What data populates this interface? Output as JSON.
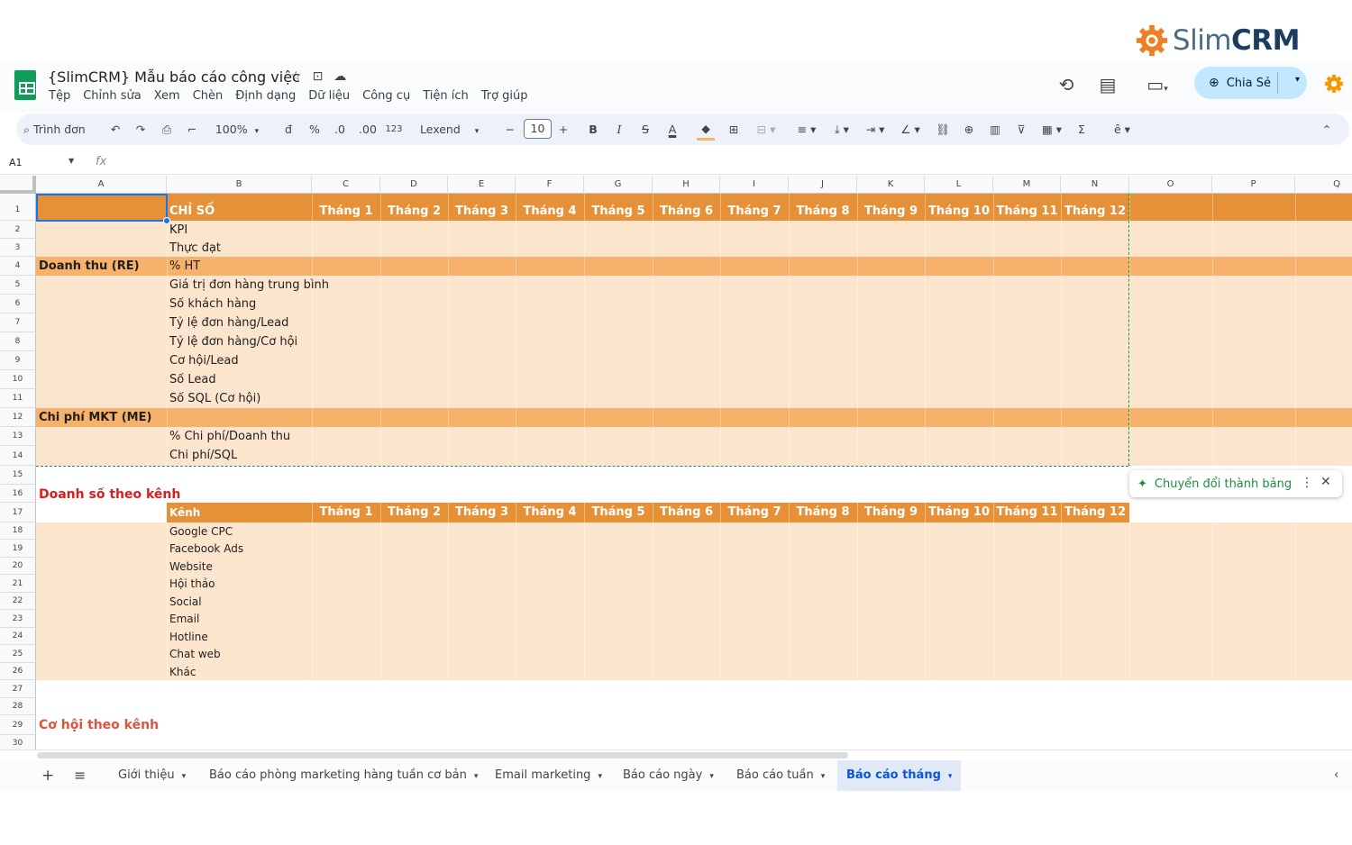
{
  "brand": {
    "logo_light": "Slim",
    "logo_bold": "CRM",
    "accent": "#ef7e24"
  },
  "doc": {
    "title": "{SlimCRM} Mẫu báo cáo công việc"
  },
  "menu": [
    "Tệp",
    "Chỉnh sửa",
    "Xem",
    "Chèn",
    "Định dạng",
    "Dữ liệu",
    "Công cụ",
    "Tiện ích",
    "Trợ giúp"
  ],
  "share_label": "Chia Sẻ",
  "toolbar": {
    "search": "Trình đơn",
    "zoom": "100%",
    "currency": "đ",
    "percent": "%",
    "dec_less": ".0",
    "dec_more": ".00",
    "number_format": "123",
    "font": "Lexend",
    "font_size": "10",
    "bold": "B",
    "italic": "I",
    "strike": "S",
    "text_color": "A",
    "sum": "Σ"
  },
  "formula_bar": {
    "cell_ref": "A1",
    "fx": "fx"
  },
  "columns": [
    "A",
    "B",
    "C",
    "D",
    "E",
    "F",
    "G",
    "H",
    "I",
    "J",
    "K",
    "L",
    "M",
    "N",
    "O",
    "P",
    "Q"
  ],
  "rows": [
    "1",
    "2",
    "3",
    "4",
    "5",
    "6",
    "7",
    "8",
    "9",
    "10",
    "11",
    "12",
    "13",
    "14",
    "15",
    "16",
    "17",
    "18",
    "19",
    "20",
    "21",
    "22",
    "23",
    "24",
    "25",
    "26",
    "27",
    "28",
    "29",
    "30"
  ],
  "months": [
    "Tháng 1",
    "Tháng 2",
    "Tháng 3",
    "Tháng 4",
    "Tháng 5",
    "Tháng 6",
    "Tháng 7",
    "Tháng 8",
    "Tháng 9",
    "Tháng 10",
    "Tháng 11",
    "Tháng 12"
  ],
  "table1": {
    "header": "CHỈ SỐ",
    "rows": [
      {
        "a": "",
        "b": "KPI"
      },
      {
        "a": "",
        "b": "Thực đạt"
      },
      {
        "a": "Doanh thu (RE)",
        "b": "% HT"
      },
      {
        "a": "",
        "b": "Giá trị đơn hàng trung bình"
      },
      {
        "a": "",
        "b": "Số khách hàng"
      },
      {
        "a": "",
        "b": "Tỷ lệ đơn hàng/Lead"
      },
      {
        "a": "",
        "b": "Tỷ lệ đơn hàng/Cơ hội"
      },
      {
        "a": "",
        "b": "Cơ hội/Lead"
      },
      {
        "a": "",
        "b": "Số Lead"
      },
      {
        "a": "",
        "b": "Số SQL (Cơ hội)"
      },
      {
        "a": "Chi phí MKT (ME)",
        "b": ""
      },
      {
        "a": "",
        "b": "% Chi phí/Doanh thu"
      },
      {
        "a": "",
        "b": "Chi phí/SQL"
      }
    ]
  },
  "section2": {
    "title": "Doanh số theo kênh",
    "header": "Kênh",
    "channels": [
      "Google CPC",
      "Facebook Ads",
      "Website",
      "Hội thảo",
      "Social",
      "Email",
      "Hotline",
      "Chat web",
      "Khác"
    ]
  },
  "section3": {
    "title": "Cơ hội theo kênh"
  },
  "convert_chip": "Chuyển đổi thành bảng",
  "sheet_tabs": [
    "Giới thiệu",
    "Báo cáo phòng marketing hàng tuần cơ bản",
    "Email marketing",
    "Báo cáo ngày",
    "Báo cáo tuần",
    "Báo cáo tháng"
  ]
}
